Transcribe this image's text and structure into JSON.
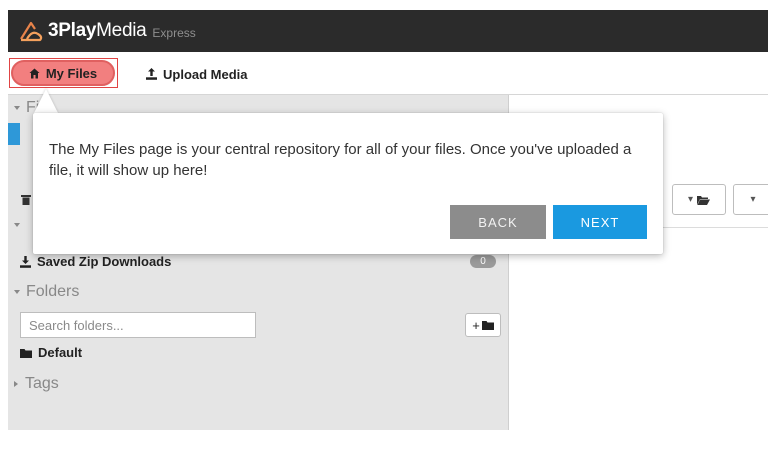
{
  "app": {
    "brand_bold": "3Play",
    "brand_regular": "Media",
    "edition": "Express",
    "logo_icon": "3play-logo-icon"
  },
  "nav": {
    "my_files": "My Files",
    "upload_media": "Upload Media",
    "my_files_icon": "home-icon",
    "upload_icon": "upload-icon"
  },
  "sidebar": {
    "files_heading_partial": "File",
    "saved_zip_downloads": "Saved Zip Downloads",
    "saved_zip_count": "0",
    "folders_heading": "Folders",
    "search_placeholder": "Search folders...",
    "add_folder_label": "+",
    "default_folder": "Default",
    "tags_heading": "Tags"
  },
  "tour": {
    "message": "The My Files page is your central repository for all of your files. Once you've uploaded a file, it will show up here!",
    "back_label": "BACK",
    "next_label": "NEXT"
  },
  "colors": {
    "header_bg": "#2b2b2b",
    "my_files_active": "#f27f7f",
    "sidebar_bg": "#e5e5e5",
    "next_button": "#1a99e0",
    "back_button": "#8c8c8c",
    "selected_item": "#2e98d8"
  }
}
